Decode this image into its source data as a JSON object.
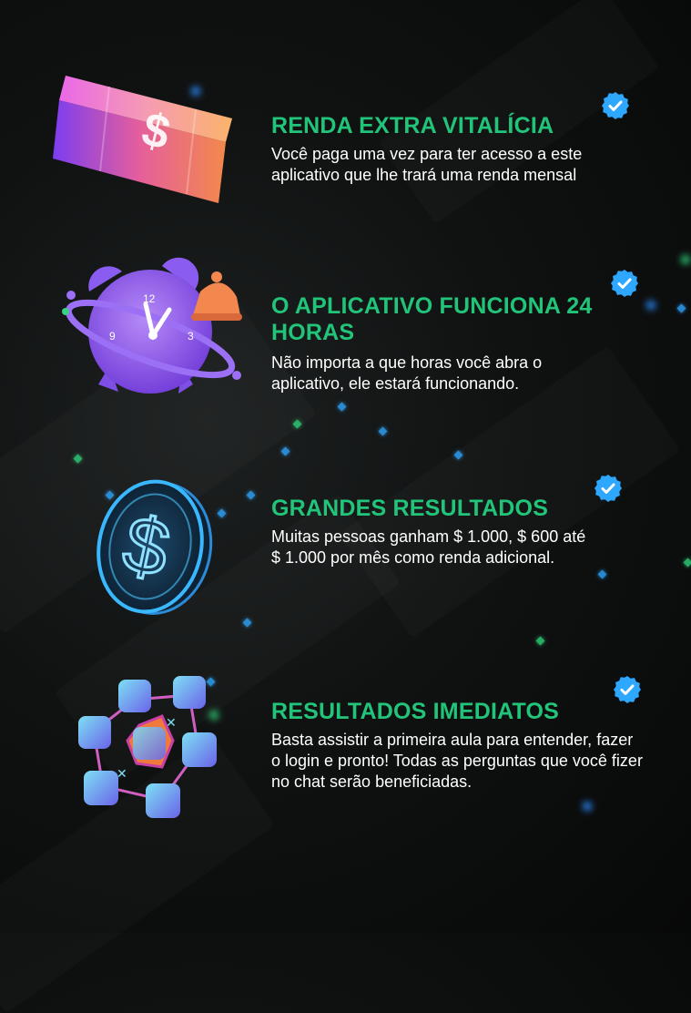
{
  "features": [
    {
      "title": "RENDA EXTRA VITALÍCIA",
      "description": "Você paga uma vez para ter acesso a este aplicativo que lhe trará uma renda mensal",
      "icon": "money-stack-icon"
    },
    {
      "title": "O APLICATIVO FUNCIONA 24 HORAS",
      "description": "Não importa a que horas você abra o aplicativo, ele estará funcionando.",
      "icon": "alarm-clock-icon"
    },
    {
      "title": "GRANDES RESULTADOS",
      "description": "Muitas pessoas ganham $ 1.000, $ 600 até $ 1.000 por mês como renda adicional.",
      "icon": "neon-dollar-coin-icon"
    },
    {
      "title": "RESULTADOS IMEDIATOS",
      "description": "Basta assistir a primeira aula para entender, fazer o login e pronto! Todas as perguntas que você fizer no chat serão beneficiadas.",
      "icon": "blockchain-cubes-icon"
    }
  ],
  "clock": {
    "n12": "12",
    "n3": "3",
    "n9": "9"
  },
  "coin_symbol": "$",
  "bill_symbol": "$",
  "colors": {
    "title": "#22c47a",
    "text": "#ffffff",
    "badge": "#2ea7ff",
    "background": "#0b0c0c"
  }
}
